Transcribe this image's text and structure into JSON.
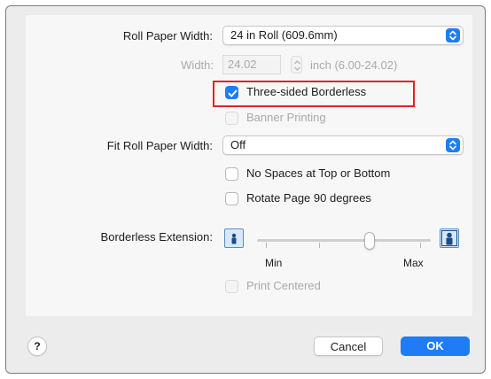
{
  "roll_paper_width": {
    "label": "Roll Paper Width:",
    "value": "24 in Roll (609.6mm)"
  },
  "width": {
    "label": "Width:",
    "value": "24.02",
    "unit_range": "inch (6.00-24.02)"
  },
  "options": {
    "three_sided_borderless": {
      "label": "Three-sided Borderless",
      "checked": true
    },
    "banner_printing": {
      "label": "Banner Printing",
      "checked": false,
      "enabled": false
    }
  },
  "fit_roll_paper_width": {
    "label": "Fit Roll Paper Width:",
    "value": "Off"
  },
  "options2": {
    "no_spaces": {
      "label": "No Spaces at Top or Bottom",
      "checked": false
    },
    "rotate_page": {
      "label": "Rotate Page 90 degrees",
      "checked": false
    }
  },
  "borderless_extension": {
    "label": "Borderless Extension:",
    "min_label": "Min",
    "max_label": "Max",
    "level_fraction": 0.67,
    "min_icon": "person-small-icon",
    "max_icon": "person-large-icon"
  },
  "print_centered": {
    "label": "Print Centered",
    "checked": false,
    "enabled": false
  },
  "footer": {
    "help_label": "?",
    "cancel_label": "Cancel",
    "ok_label": "OK"
  },
  "colors": {
    "accent": "#1f7cf4",
    "highlight": "#e32222",
    "disabled_text": "#a9a9a9"
  }
}
